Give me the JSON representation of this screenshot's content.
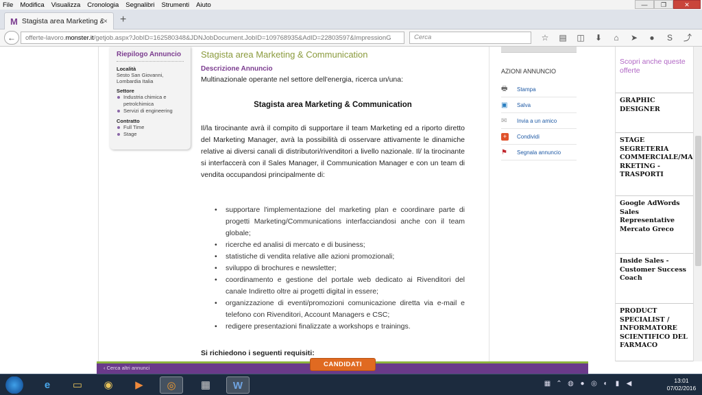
{
  "menubar": {
    "items": [
      "File",
      "Modifica",
      "Visualizza",
      "Cronologia",
      "Segnalibri",
      "Strumenti",
      "Aiuto"
    ]
  },
  "window_controls": {
    "minimize": "—",
    "maximize": "❐",
    "close": "✕"
  },
  "tab": {
    "title": "Stagista area Marketing & ...",
    "favicon": "M",
    "close": "×"
  },
  "newtab": "+",
  "navbar": {
    "back": "←",
    "url_prefix": "offerte-lavoro.",
    "url_host": "monster.it",
    "url_rest": "/getjob.aspx?JobID=162580348&JDNJobDocument.JobID=109768935&AdID=22803597&ImpressionG",
    "search_placeholder": "Cerca"
  },
  "summary": {
    "title": "Riepilogo Annuncio",
    "location_label": "Località",
    "location_value": "Sesto San Giovanni, Lombardia Italia",
    "sector_label": "Settore",
    "sectors": [
      "Industria chimica e petrolchimica",
      "Servizi di engineering"
    ],
    "contract_label": "Contratto",
    "contracts": [
      "Full Time",
      "Stage"
    ]
  },
  "content": {
    "title": "Stagista area Marketing & Communication",
    "desc_heading": "Descrizione Annuncio",
    "intro": "Multinazionale operante nel settore dell'energia, ricerca un/una:",
    "center_title": "Stagista area Marketing & Communication",
    "body": "Il/la tirocinante avrà il compito di supportare il team Marketing ed a riporto diretto del Marketing Manager, avrà la possibilità di osservare attivamente le dinamiche relative ai diversi canali di distributori/rivenditori a livello nazionale. Il/ la tirocinante si interfaccerà con il Sales Manager, il Communication Manager e con un team di vendita occupandosi principalmente di:",
    "bullets": [
      "supportare l'implementazione del marketing plan e coordinare parte di progetti Marketing/Communications interfacciandosi anche con il team globale;",
      "ricerche ed analisi di mercato e di business;",
      "statistiche di vendita relative alle azioni promozionali;",
      "sviluppo di brochures e newsletter;",
      "coordinamento e gestione del portale web dedicato ai Rivenditori del canale Indiretto oltre ai progetti digital in essere;",
      "organizzazione di eventi/promozioni comunicazione diretta via e-mail e telefono con Rivenditori, Account Managers e CSC;",
      "redigere presentazioni finalizzate  a workshops e trainings."
    ],
    "requirements": "Si richiedono i seguenti requisiti:"
  },
  "actions": {
    "heading": "AZIONI ANNUNCIO",
    "items": [
      {
        "label": "Stampa",
        "icon": "printer-icon"
      },
      {
        "label": "Salva",
        "icon": "floppy-disk-icon"
      },
      {
        "label": "Invia a un amico",
        "icon": "envelope-icon"
      },
      {
        "label": "Condividi",
        "icon": "plus-share-icon"
      },
      {
        "label": "Segnala annuncio",
        "icon": "flag-icon"
      }
    ]
  },
  "related": {
    "heading": "Scopri anche queste offerte",
    "jobs": [
      "GRAPHIC DESIGNER",
      "STAGE SEGRETERIA COMMERCIALE/MA RKETING - TRASPORTI",
      "Google AdWords Sales Representative Mercato Greco",
      "Inside Sales - Customer Success Coach",
      "PRODUCT SPECIALIST / INFORMATORE SCIENTIFICO DEL FARMACO"
    ]
  },
  "footer": {
    "cerca_altri": "‹ Cerca altri annunci",
    "cta": "CANDIDATI"
  },
  "taskbar": {
    "time": "13:01",
    "date": "07/02/2016"
  }
}
